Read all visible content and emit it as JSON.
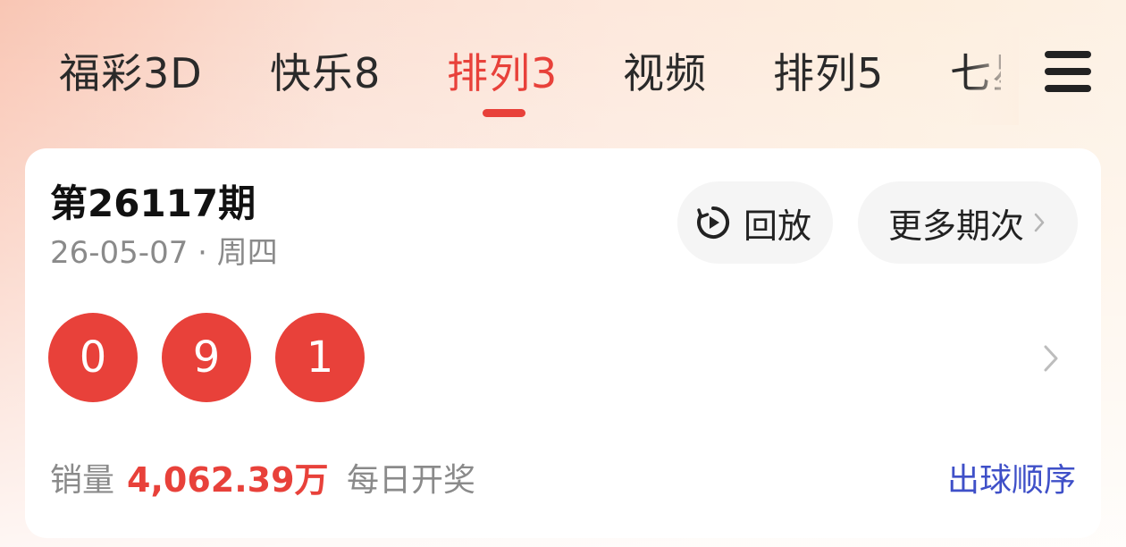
{
  "tabs": [
    {
      "label": "福彩3D",
      "active": false
    },
    {
      "label": "快乐8",
      "active": false
    },
    {
      "label": "排列3",
      "active": true
    },
    {
      "label": "视频",
      "active": false
    },
    {
      "label": "排列5",
      "active": false
    },
    {
      "label": "七星彩",
      "active": false
    }
  ],
  "menu": {
    "icon": "hamburger-menu-icon"
  },
  "draw": {
    "issue": "第26117期",
    "date": "26-05-07 · 周四",
    "numbers": [
      "0",
      "9",
      "1"
    ],
    "replay_label": "回放",
    "more_label": "更多期次",
    "sales_label": "销量",
    "sales_value": "4,062.39万",
    "frequency": "每日开奖",
    "order_link": "出球顺序"
  },
  "colors": {
    "accent": "#e8413a",
    "link": "#3f50c8",
    "text": "#2a2a2a",
    "muted": "#8a8a8a"
  }
}
